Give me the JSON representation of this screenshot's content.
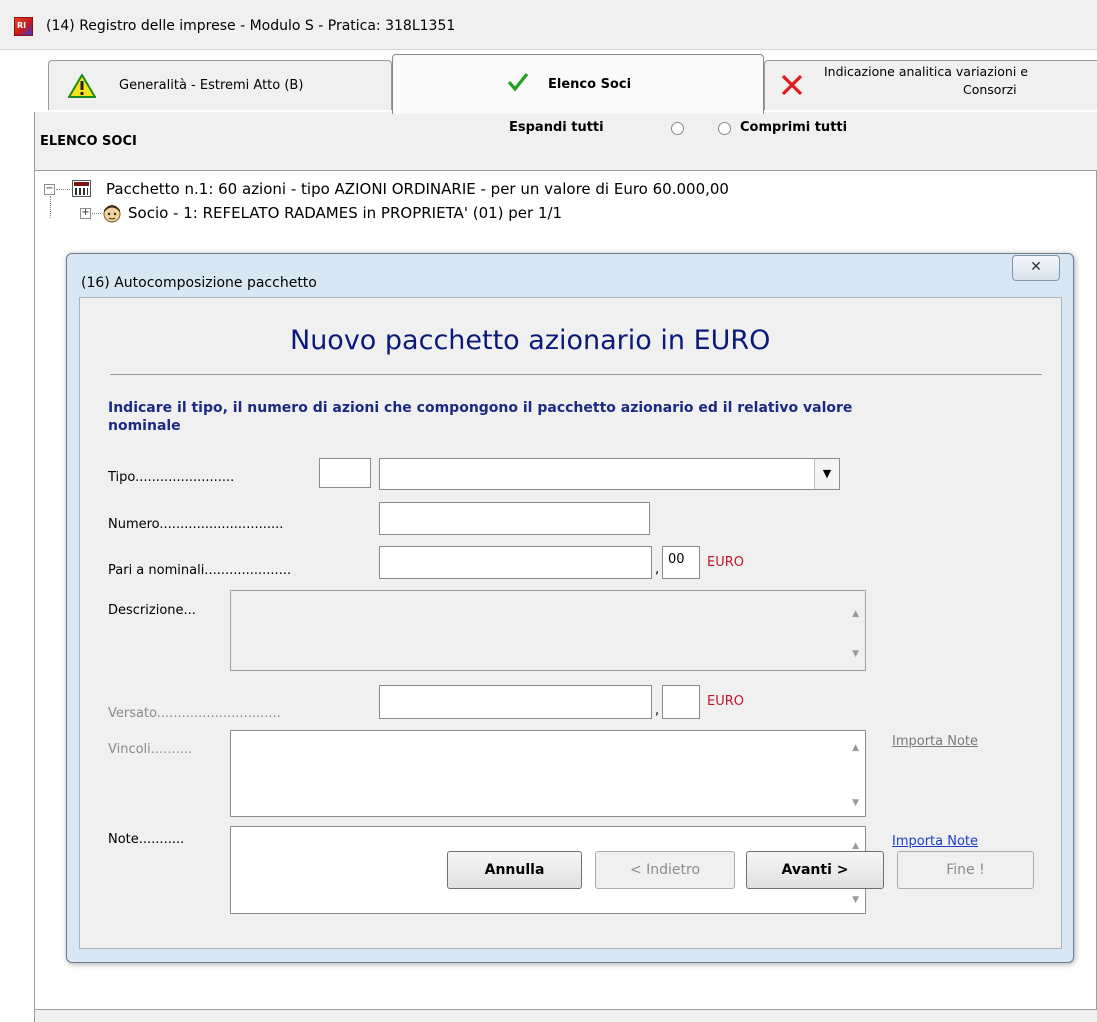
{
  "window": {
    "title": "(14) Registro delle imprese - Modulo S - Pratica: 318L1351",
    "app_icon": "registro-app-icon"
  },
  "tabs": [
    {
      "label": "Generalità - Estremi Atto (B)",
      "icon": "warning-triangle-icon",
      "state": "warning"
    },
    {
      "label": "Elenco Soci",
      "icon": "green-checkmark-icon",
      "state": "selected"
    },
    {
      "label_line1": "Indicazione analitica variazioni e",
      "label_line2": "Consorzi",
      "icon": "red-cross-icon",
      "state": "error"
    }
  ],
  "section": {
    "title": "ELENCO SOCI",
    "expand_all": "Espandi tutti",
    "collapse_all": "Comprimi tutti"
  },
  "tree": {
    "package": "Pacchetto n.1: 60 azioni - tipo AZIONI ORDINARIE - per un valore di Euro 60.000,00",
    "socio": "Socio - 1: REFELATO RADAMES in PROPRIETA' (01) per 1/1",
    "package_toggle": "−",
    "socio_toggle": "+"
  },
  "dialog": {
    "title": "(16) Autocomposizione pacchetto",
    "close_glyph": "✕",
    "heading": "Nuovo pacchetto azionario in EURO",
    "instructions": "Indicare il tipo, il numero di azioni che compongono il pacchetto azionario ed il relativo valore nominale",
    "fields": {
      "tipo_label": "Tipo........................",
      "tipo_code": "",
      "tipo_value": "",
      "numero_label": "Numero..............................",
      "numero_value": "",
      "nominali_label": "Pari a  nominali.....................",
      "nominali_int": "",
      "nominali_dec": "00",
      "nominali_currency": "EURO",
      "descrizione_label": "Descrizione...",
      "descrizione_value": "",
      "versato_label": "Versato..............................",
      "versato_int": "",
      "versato_dec": "",
      "versato_currency": "EURO",
      "vincoli_label": "Vincoli..........",
      "vincoli_value": "",
      "note_label": "Note...........",
      "note_value": "",
      "comma": ","
    },
    "links": {
      "vincoli_import": "Importa Note",
      "note_import": "Importa Note"
    },
    "buttons": {
      "annulla": "Annulla",
      "indietro": "< Indietro",
      "avanti": "Avanti >",
      "fine": "Fine !"
    }
  },
  "colors": {
    "heading": "#0a1a7a",
    "instructions": "#1a2a85",
    "euro": "#c0152a",
    "link_enabled": "#1a3cc8",
    "link_disabled": "#7a7a7a",
    "dialog_frame": "#d9e7f4"
  }
}
